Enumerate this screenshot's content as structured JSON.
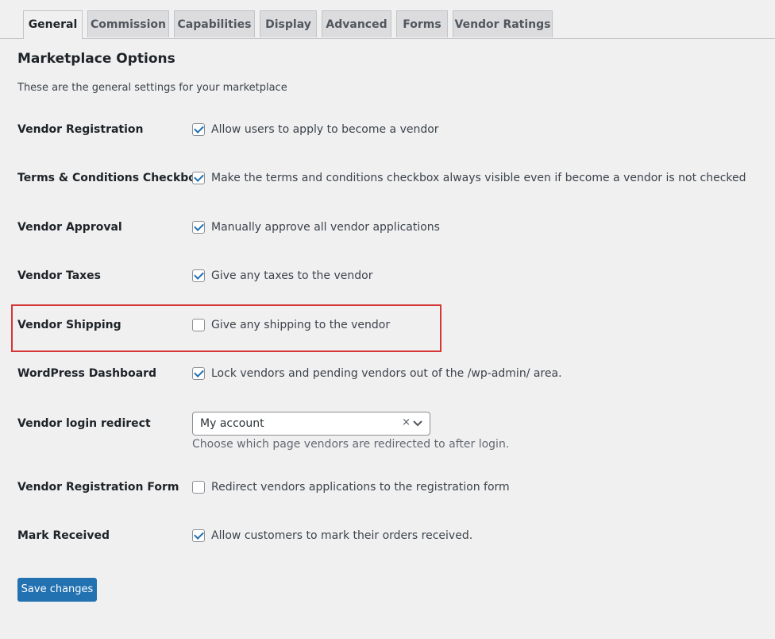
{
  "tabs": [
    {
      "label": "General",
      "active": true
    },
    {
      "label": "Commission",
      "active": false
    },
    {
      "label": "Capabilities",
      "active": false
    },
    {
      "label": "Display",
      "active": false
    },
    {
      "label": "Advanced",
      "active": false
    },
    {
      "label": "Forms",
      "active": false
    },
    {
      "label": "Vendor Ratings",
      "active": false
    }
  ],
  "section": {
    "title": "Marketplace Options",
    "description": "These are the general settings for your marketplace"
  },
  "settings": [
    {
      "label": "Vendor Registration",
      "text": "Allow users to apply to become a vendor",
      "checked": true
    },
    {
      "label": "Terms & Conditions Checkbox",
      "text": "Make the terms and conditions checkbox always visible even if become a vendor is not checked",
      "checked": true
    },
    {
      "label": "Vendor Approval",
      "text": "Manually approve all vendor applications",
      "checked": true
    },
    {
      "label": "Vendor Taxes",
      "text": "Give any taxes to the vendor",
      "checked": true
    },
    {
      "label": "Vendor Shipping",
      "text": "Give any shipping to the vendor",
      "checked": false
    },
    {
      "label": "WordPress Dashboard",
      "text": "Lock vendors and pending vendors out of the /wp-admin/ area.",
      "checked": true
    },
    {
      "label": "Vendor Registration Form",
      "text": "Redirect vendors applications to the registration form",
      "checked": false
    },
    {
      "label": "Mark Received",
      "text": "Allow customers to mark their orders received.",
      "checked": true
    }
  ],
  "login_redirect": {
    "label": "Vendor login redirect",
    "selected": "My account",
    "clear_symbol": "×",
    "help": "Choose which page vendors are redirected to after login."
  },
  "save_label": "Save changes",
  "colors": {
    "accent": "#2271b1",
    "highlight_border": "#d63638",
    "background": "#f0f0f1"
  }
}
